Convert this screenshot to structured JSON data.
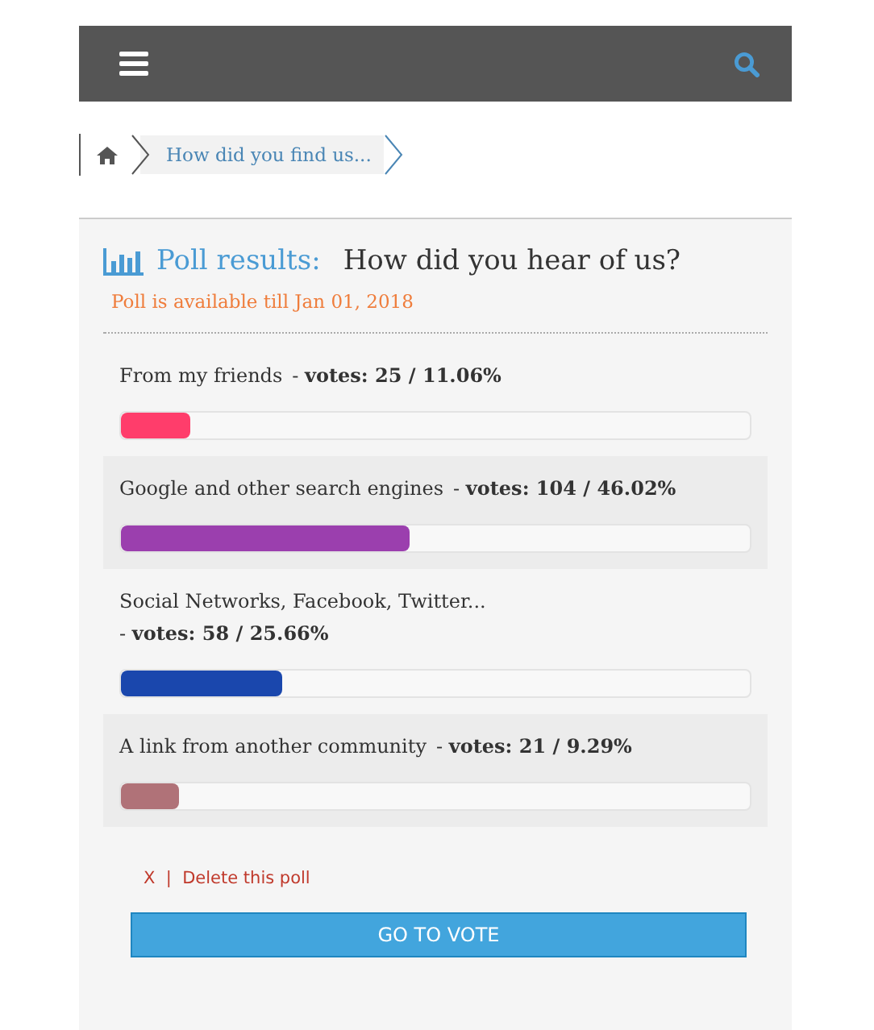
{
  "breadcrumb": {
    "current": "How did you find us..."
  },
  "poll": {
    "heading": "Poll results:",
    "question": "How did you hear of us?",
    "availability": "Poll is available till Jan 01, 2018",
    "options": [
      {
        "label": "From my friends",
        "votes": "-  **votes: 25 / 11.06%**",
        "level": 0.11,
        "color": "#ff3d6b"
      },
      {
        "label": "Google and other search engines",
        "votes": "-  **votes: 104 / 46.02%**",
        "level": 0.46,
        "color": "#9b3fae"
      },
      {
        "label": "Social Networks, Facebook, Twitter...",
        "votes": "-  **votes: 58 / 25.66%**",
        "level": 0.2566,
        "color": "#1a47ad"
      },
      {
        "label": "A link from another community",
        "votes": "-  **votes: 21 / 9.29%**",
        "level": 0.0929,
        "color": "#b07278"
      }
    ],
    "delete_link": "X  |  Delete this poll",
    "vote_button": "GO TO VOTE"
  }
}
